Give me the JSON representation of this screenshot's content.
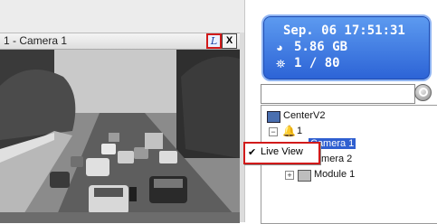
{
  "camera_window": {
    "title": "1 - Camera 1",
    "mode_button_label": "L",
    "close_button_label": "X"
  },
  "status_panel": {
    "datetime": "Sep. 06 17:51:31",
    "storage": "5.86 GB",
    "cameras": "1 / 80",
    "accent_color": "#3a75e0"
  },
  "search": {
    "value": "",
    "placeholder": ""
  },
  "tree": {
    "root_label": "CenterV2",
    "group_label": "1",
    "camera1_label": "Camera 1",
    "camera2_label": "Camera 2",
    "module_label": "Module 1"
  },
  "context_menu": {
    "check_mark": "✔",
    "live_view_label": "Live View"
  }
}
